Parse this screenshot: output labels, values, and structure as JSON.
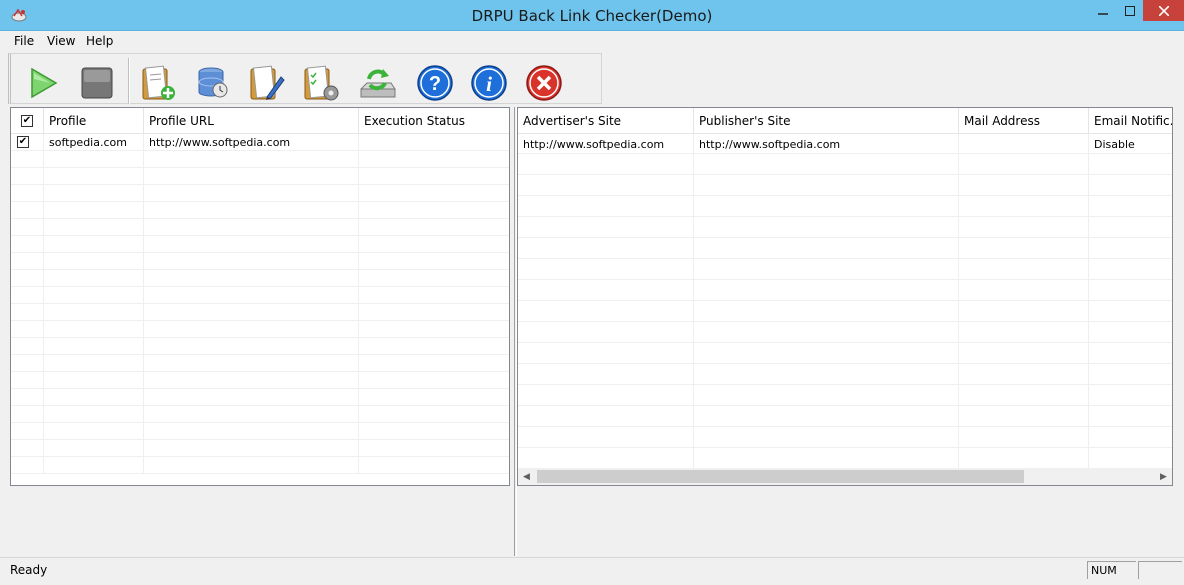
{
  "window": {
    "title": "DRPU Back Link Checker(Demo)",
    "icon": "app-logo-icon",
    "controls": {
      "minimize": "—",
      "maximize": "□",
      "close": "✕"
    }
  },
  "menu": [
    {
      "label": "File"
    },
    {
      "label": "View"
    },
    {
      "label": "Help"
    }
  ],
  "toolbar": [
    {
      "name": "start-icon"
    },
    {
      "name": "stop-icon"
    },
    {
      "name": "add-profile-icon"
    },
    {
      "name": "database-icon"
    },
    {
      "name": "edit-profile-icon"
    },
    {
      "name": "settings-list-icon"
    },
    {
      "name": "refresh-drive-icon"
    },
    {
      "name": "help-icon",
      "glyph": "?"
    },
    {
      "name": "info-icon",
      "glyph": "i"
    },
    {
      "name": "exit-icon",
      "glyph": "✕"
    }
  ],
  "profiles": {
    "header_check": "✔",
    "columns": [
      "Profile",
      "Profile URL",
      "Execution Status"
    ],
    "rows": [
      {
        "checked": "✔",
        "profile": "softpedia.com",
        "url": "http://www.softpedia.com",
        "status": ""
      }
    ]
  },
  "links": {
    "columns": [
      "Advertiser's Site",
      "Publisher's Site",
      "Mail Address",
      "Email Notific..."
    ],
    "rows": [
      {
        "advertiser": "http://www.softpedia.com",
        "publisher": "http://www.softpedia.com",
        "mail": "",
        "notify": "Disable"
      }
    ],
    "scroll_left": "◀",
    "scroll_right": "▶"
  },
  "status": {
    "text": "Ready",
    "num": "NUM"
  },
  "colors": {
    "titlebar": "#6ec4ec",
    "close_button": "#c7423a",
    "play_green": "#4caf50",
    "help_blue": "#1e6fd9",
    "exit_red": "#d9342b"
  }
}
